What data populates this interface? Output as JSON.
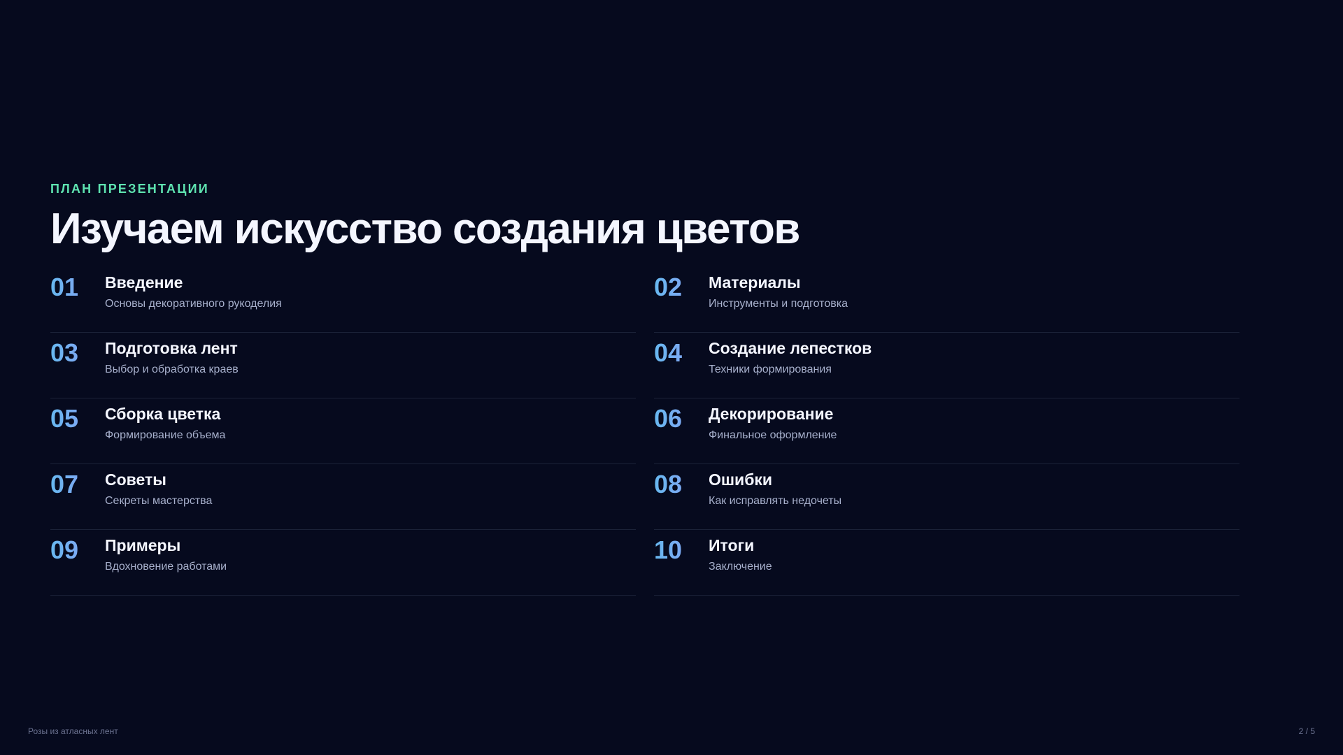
{
  "slide": {
    "eyebrow": "ПЛАН ПРЕЗЕНТАЦИИ",
    "title": "Изучаем искусство создания цветов"
  },
  "agenda": [
    {
      "num": "01",
      "title": "Введение",
      "subtitle": "Основы декоративного рукоделия"
    },
    {
      "num": "02",
      "title": "Материалы",
      "subtitle": "Инструменты и подготовка"
    },
    {
      "num": "03",
      "title": "Подготовка лент",
      "subtitle": "Выбор и обработка краев"
    },
    {
      "num": "04",
      "title": "Создание лепестков",
      "subtitle": "Техники формирования"
    },
    {
      "num": "05",
      "title": "Сборка цветка",
      "subtitle": "Формирование объема"
    },
    {
      "num": "06",
      "title": "Декорирование",
      "subtitle": "Финальное оформление"
    },
    {
      "num": "07",
      "title": "Советы",
      "subtitle": "Секреты мастерства"
    },
    {
      "num": "08",
      "title": "Ошибки",
      "subtitle": "Как исправлять недочеты"
    },
    {
      "num": "09",
      "title": "Примеры",
      "subtitle": "Вдохновение работами"
    },
    {
      "num": "10",
      "title": "Итоги",
      "subtitle": "Заключение"
    }
  ],
  "footer": {
    "deck_title": "Розы из атласных лент",
    "page_indicator": "2 / 5"
  },
  "colors": {
    "background": "#060a1e",
    "accent_eyebrow": "#5ee3b0",
    "number_gradient_start": "#67b8f0",
    "number_gradient_end": "#8f9cf6",
    "title_text": "#f4f6ff",
    "subtitle_text": "#a7b0cc",
    "divider": "#1b2238"
  }
}
